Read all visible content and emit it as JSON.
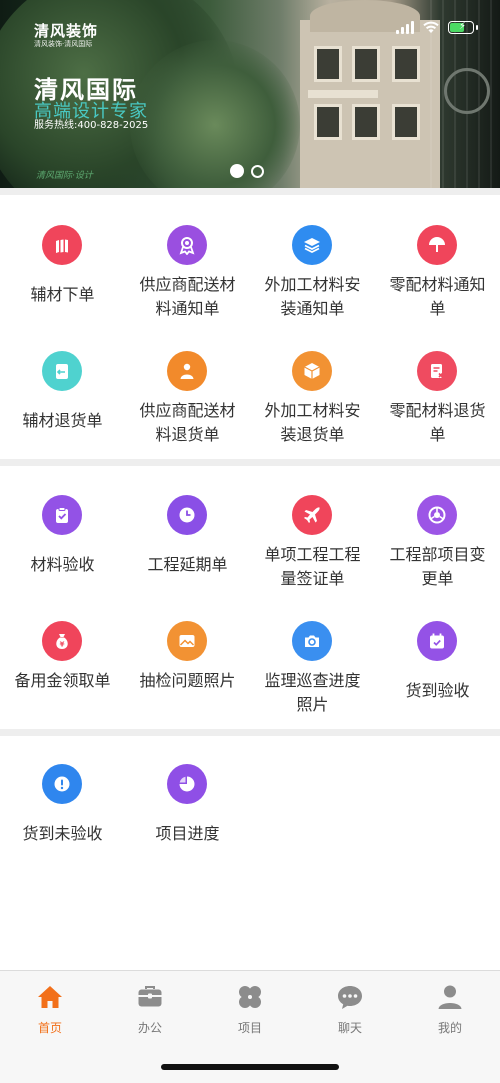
{
  "banner": {
    "logo_text": "清风装饰",
    "logo_sub": "清风装饰·清风国际",
    "brand": "清风国际",
    "slogan": "高端设计专家",
    "hotline": "服务热线:400-828-2025",
    "signature": "清风国际·设计",
    "slides_total": 2,
    "slide_active": 1
  },
  "sections": [
    {
      "items": [
        {
          "label": "辅材下单",
          "icon": "bars-icon",
          "color": "#f0455b",
          "lines": 1
        },
        {
          "label": "供应商配送材料通知单",
          "icon": "badge-icon",
          "color": "#9a4fe0",
          "lines": 2
        },
        {
          "label": "外加工材料安装通知单",
          "icon": "layers-icon",
          "color": "#2f8cf0",
          "lines": 2
        },
        {
          "label": "零配材料通知单",
          "icon": "umbrella-icon",
          "color": "#f0455b",
          "lines": 2
        },
        {
          "label": "辅材退货单",
          "icon": "return-icon",
          "color": "#4fd2cf",
          "lines": 1
        },
        {
          "label": "供应商配送材料退货单",
          "icon": "person-icon",
          "color": "#f28a2b",
          "lines": 2
        },
        {
          "label": "外加工材料安装退货单",
          "icon": "box-icon",
          "color": "#f29233",
          "lines": 2
        },
        {
          "label": "零配材料退货单",
          "icon": "doc-x-icon",
          "color": "#ef4b60",
          "lines": 2
        }
      ]
    },
    {
      "items": [
        {
          "label": "材料验收",
          "icon": "clipboard-check-icon",
          "color": "#9352e6",
          "lines": 1
        },
        {
          "label": "工程延期单",
          "icon": "clock-icon",
          "color": "#8a4fe6",
          "lines": 1
        },
        {
          "label": "单项工程工程量签证单",
          "icon": "plane-icon",
          "color": "#f0455b",
          "lines": 2
        },
        {
          "label": "工程部项目变更单",
          "icon": "chrome-icon",
          "color": "#9c55e6",
          "lines": 2
        },
        {
          "label": "备用金领取单",
          "icon": "money-bag-icon",
          "color": "#f0455b",
          "lines": 2
        },
        {
          "label": "抽检问题照片",
          "icon": "image-icon",
          "color": "#f29233",
          "lines": 2
        },
        {
          "label": "监理巡查进度照片",
          "icon": "camera-icon",
          "color": "#3a8ff0",
          "lines": 2
        },
        {
          "label": "货到验收",
          "icon": "calendar-check-icon",
          "color": "#9452e6",
          "lines": 1
        }
      ]
    },
    {
      "items": [
        {
          "label": "货到未验收",
          "icon": "exclamation-icon",
          "color": "#2f86ee",
          "lines": 1
        },
        {
          "label": "项目进度",
          "icon": "pie-icon",
          "color": "#8f4fe6",
          "lines": 1
        }
      ]
    }
  ],
  "tabbar": {
    "active": 0,
    "tabs": [
      {
        "label": "首页",
        "icon": "home-icon"
      },
      {
        "label": "办公",
        "icon": "briefcase-icon"
      },
      {
        "label": "项目",
        "icon": "clover-icon"
      },
      {
        "label": "聊天",
        "icon": "chat-icon"
      },
      {
        "label": "我的",
        "icon": "user-icon"
      }
    ]
  },
  "colors": {
    "accent": "#f2701a",
    "tab_inactive": "#8c8c8c",
    "divider": "#eeeeee"
  }
}
